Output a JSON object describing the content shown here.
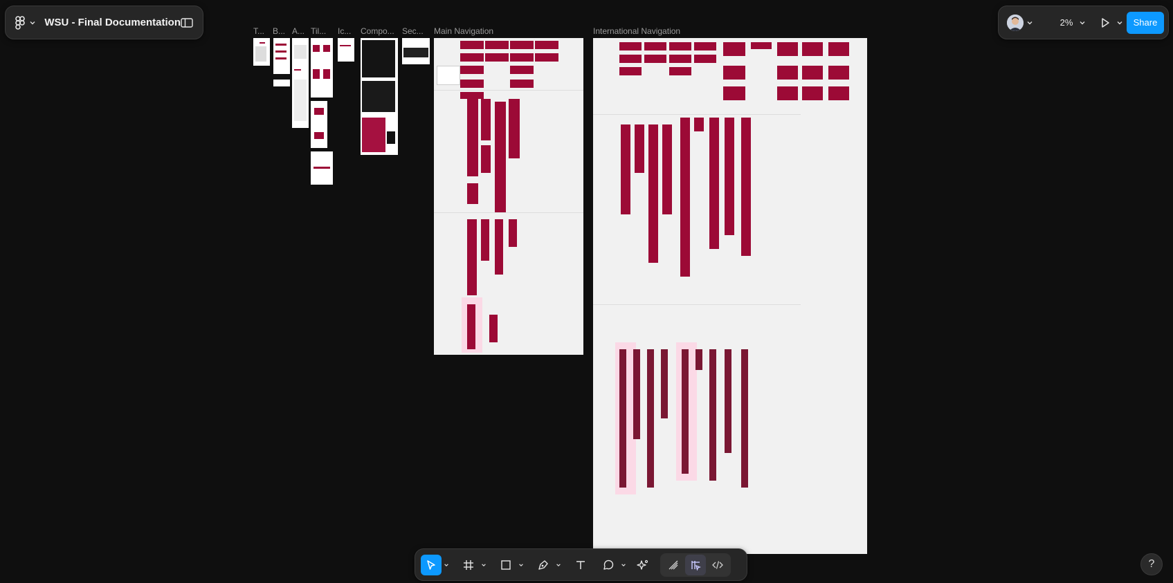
{
  "app": {
    "document_title": "WSU - Final Documentation",
    "menu_icon": "figma-logo-icon",
    "sidebar_icon": "sidebar-toggle-icon"
  },
  "header_right": {
    "zoom_level": "2%",
    "share_label": "Share",
    "avatar_icon": "user-avatar",
    "play_icon": "present-play-icon"
  },
  "canvas": {
    "frame_labels": [
      "T...",
      "B...",
      "A...",
      "Til...",
      "Ic...",
      "Compo...",
      "Sec...",
      "Main Navigation",
      "International Navigation"
    ],
    "colors": {
      "canvas_bg": "#0f0f0f",
      "frame_bg": "#f1f1f1",
      "brand_crimson": "#9c0a36",
      "accent_blue": "#0d99ff"
    }
  },
  "toolbar": {
    "tools": [
      "move-tool",
      "frame-tool",
      "shape-tool",
      "pen-tool",
      "text-tool",
      "comment-tool",
      "actions-tool"
    ],
    "dev_tools": [
      "draw-mode",
      "design-mode",
      "dev-mode"
    ]
  },
  "help": {
    "label": "?"
  }
}
